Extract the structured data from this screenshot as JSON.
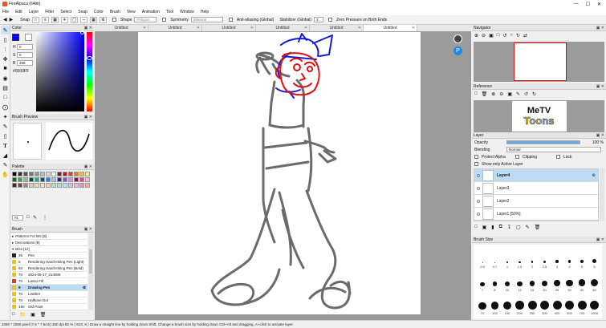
{
  "app": {
    "title": "FireAlpaca (64bit)"
  },
  "menu": [
    "File",
    "Edit",
    "Layer",
    "Filter",
    "Select",
    "Snap",
    "Color",
    "Brush",
    "View",
    "Animation",
    "Tool",
    "Window",
    "Help"
  ],
  "toolbar": {
    "snap_label": "Snap",
    "shape_label": "Shape",
    "shape_value": "Polygon",
    "symmetry_label": "Symmetry",
    "symmetry_value": "Bilateral",
    "antialias_label": "Anti-aliasing (Global)",
    "stabilizer_label": "Stabilizer (Global)",
    "stabilizer_value": "2",
    "zero_pressure_label": "Zero Pressure on Both Ends"
  },
  "tabs": [
    "Untitled",
    "Untitled",
    "Untitled",
    "Untitled",
    "Untitled",
    "Untitled"
  ],
  "color_panel": {
    "title": "Color",
    "h": "0",
    "s": "0",
    "b": "255",
    "hex": "#0000FF",
    "h_label": "H",
    "s_label": "S",
    "b_label": "B"
  },
  "brush_preview": {
    "title": "Brush Preview"
  },
  "palette": {
    "title": "Palette",
    "index": "#1"
  },
  "brush_panel": {
    "title": "Brush",
    "groups": [
      {
        "label": "Patterns For BG [8]"
      },
      {
        "label": "Decorations [8]"
      },
      {
        "label": "BGs [12]"
      }
    ],
    "items": [
      {
        "size": "35",
        "name": "Pen",
        "color": "#222222",
        "active": false
      },
      {
        "size": "5",
        "name": "Rendering Hand-Inking Pen (Light)",
        "color": "#f2c200",
        "active": false
      },
      {
        "size": "93",
        "name": "Rendering Hand-Inking Pen (Bold)",
        "color": "#f2c200",
        "active": false
      },
      {
        "size": "70",
        "name": "2024-05-17_214006",
        "color": "#f2c200",
        "active": false
      },
      {
        "size": "70",
        "name": "Lasso Fill",
        "color": "#e83a1a",
        "active": false
      },
      {
        "size": "9",
        "name": "Drawing Pen",
        "color": "#f2c200",
        "active": true
      },
      {
        "size": "70",
        "name": "Leather",
        "color": "#f2c200",
        "active": false
      },
      {
        "size": "70",
        "name": "Halftone Dot",
        "color": "#f2c200",
        "active": false
      },
      {
        "size": "150",
        "name": "Old Paint",
        "color": "#f2c200",
        "active": false
      }
    ]
  },
  "navigator": {
    "title": "Navigator"
  },
  "reference": {
    "title": "Reference",
    "logo_top": "MeTV",
    "logo_bottom": "Toons"
  },
  "layer_panel": {
    "title": "Layer",
    "opacity_label": "Opacity",
    "opacity_value": "100 %",
    "opacity_fraction": 1.0,
    "blending_label": "Blending",
    "blending_value": "Normal",
    "protect_alpha_label": "Protect Alpha",
    "clipping_label": "Clipping",
    "lock_label": "Lock",
    "show_active_label": "Show only Active Layer",
    "layers": [
      {
        "name": "Layer4",
        "active": true
      },
      {
        "name": "Layer3",
        "active": false
      },
      {
        "name": "Layer2",
        "active": false
      },
      {
        "name": "Layer1 [50%]",
        "active": false
      }
    ]
  },
  "brush_size": {
    "title": "Brush Size",
    "row1": [
      "0.5",
      "0.7",
      "1",
      "1.5",
      "2",
      "2.5",
      "3",
      "4",
      "5",
      "6"
    ],
    "row2": [
      "7",
      "8",
      "10",
      "12",
      "15",
      "20",
      "25",
      "30",
      "40",
      "50"
    ],
    "row3": [
      "70",
      "100",
      "150",
      "200",
      "250",
      "300",
      "400",
      "500",
      "700",
      "1000"
    ]
  },
  "status": {
    "text": "1080 * 1080 pixel   (7.6 * 7.6cm)   350 dpi   82 %   ( 813, 8 )   Draw a straight line by holding down Shift, Change a brush size by holding down Ctrl+Alt and dragging, A+click to activate layer"
  },
  "colors": {
    "primary": "#0000ff",
    "secondary": "#ffffff",
    "accent_blue": "#1565c0",
    "sketch_red": "#e01010"
  }
}
